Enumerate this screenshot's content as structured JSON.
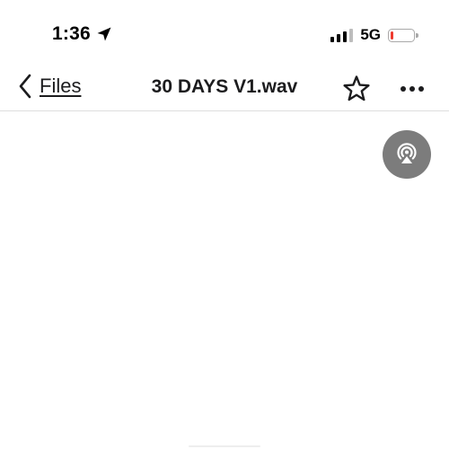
{
  "status_bar": {
    "time": "1:36",
    "location_icon": "location-arrow-icon",
    "signal_bars_active": 3,
    "signal_bars_total": 4,
    "network": "5G",
    "battery_level": 0.15,
    "battery_color": "#ee3a2e"
  },
  "nav": {
    "back_label": "Files",
    "back_icon": "chevron-left-icon",
    "title": "30 DAYS V1.wav",
    "favorite_icon": "star-outline-icon",
    "more_icon": "ellipsis-icon"
  },
  "content": {
    "airplay_icon": "airplay-audio-icon",
    "airplay_color": "#7c7c7c"
  }
}
